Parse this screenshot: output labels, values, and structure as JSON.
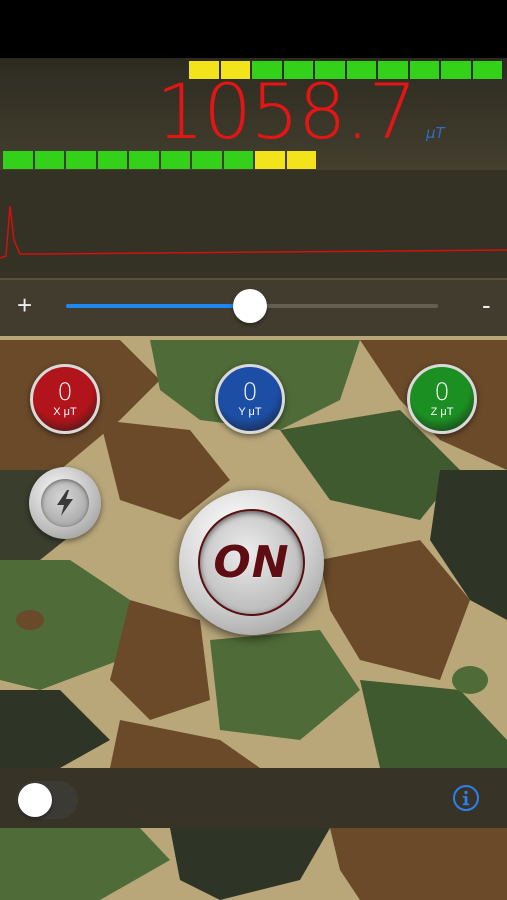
{
  "meter": {
    "reading": "1058.7",
    "unit": "μT",
    "top_bar": [
      "off",
      "off",
      "off",
      "off",
      "off",
      "off",
      "yellow",
      "yellow",
      "green",
      "green",
      "green",
      "green",
      "green",
      "green",
      "green",
      "green"
    ],
    "bottom_bar": [
      "green",
      "green",
      "green",
      "green",
      "green",
      "green",
      "green",
      "green",
      "yellow",
      "yellow",
      "off",
      "off",
      "off",
      "off",
      "off",
      "off"
    ]
  },
  "sensitivity": {
    "plus_label": "+",
    "minus_label": "-",
    "level": 0.5
  },
  "axes": [
    {
      "value": "0",
      "label": "X μT",
      "color": "#b1141a"
    },
    {
      "value": "0",
      "label": "Y μT",
      "color": "#1c4ea6"
    },
    {
      "value": "0",
      "label": "Z μT",
      "color": "#1c8f22"
    }
  ],
  "controls": {
    "on_label": "ON",
    "flash_icon": "lightning-bolt-icon",
    "toggle_on": false,
    "info_icon": "info-icon"
  },
  "colors": {
    "reading": "#e31515",
    "green_segment": "#33d11a",
    "yellow_segment": "#f2e31a",
    "slider_fill": "#1e87f0",
    "info": "#2e7ff0"
  }
}
